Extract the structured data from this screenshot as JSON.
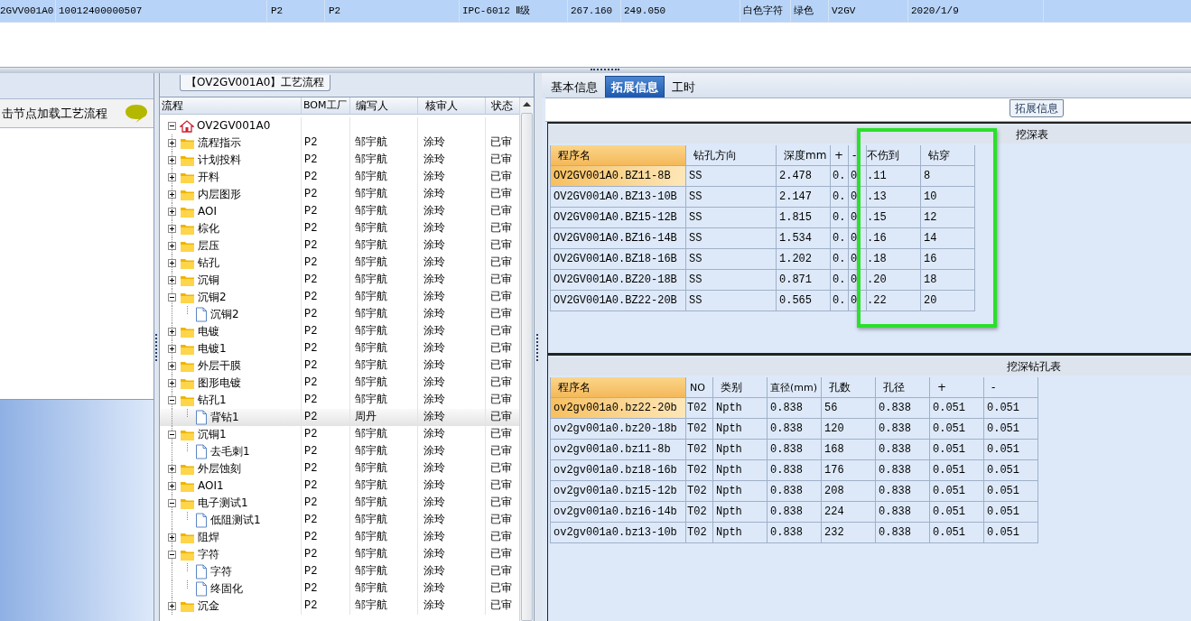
{
  "top_grid": {
    "row": {
      "selected": true,
      "cells": [
        "2GVV001A0",
        "10012400000507",
        "P2",
        "P2",
        "IPC-6012 Ⅱ级",
        "267.160",
        "249.050",
        "白色字符",
        "绿色",
        "V2GV",
        "2020/1/9"
      ]
    }
  },
  "flow_list": {
    "hint": "击节点加载工艺流程"
  },
  "process_panel": {
    "title": "【OV2GV001A0】工艺流程",
    "columns": [
      "流程",
      "BOM工厂",
      "编写人",
      "核审人",
      "状态"
    ],
    "tree": [
      {
        "label": "OV2GV001A0",
        "kind": "home",
        "expanded": true,
        "selected": false,
        "children": [
          {
            "label": "流程指示",
            "kind": "folder",
            "expanded": false,
            "selected": false,
            "bom": "P2",
            "author": "邹宇航",
            "reviewer": "涂玲",
            "status": "已审"
          },
          {
            "label": "计划投料",
            "kind": "folder",
            "expanded": false,
            "selected": false,
            "bom": "P2",
            "author": "邹宇航",
            "reviewer": "涂玲",
            "status": "已审"
          },
          {
            "label": "开料",
            "kind": "folder",
            "expanded": false,
            "selected": false,
            "bom": "P2",
            "author": "邹宇航",
            "reviewer": "涂玲",
            "status": "已审"
          },
          {
            "label": "内层图形",
            "kind": "folder",
            "expanded": false,
            "selected": false,
            "bom": "P2",
            "author": "邹宇航",
            "reviewer": "涂玲",
            "status": "已审"
          },
          {
            "label": "AOI",
            "kind": "folder",
            "expanded": false,
            "selected": false,
            "bom": "P2",
            "author": "邹宇航",
            "reviewer": "涂玲",
            "status": "已审"
          },
          {
            "label": "棕化",
            "kind": "folder",
            "expanded": false,
            "selected": false,
            "bom": "P2",
            "author": "邹宇航",
            "reviewer": "涂玲",
            "status": "已审"
          },
          {
            "label": "层压",
            "kind": "folder",
            "expanded": false,
            "selected": false,
            "bom": "P2",
            "author": "邹宇航",
            "reviewer": "涂玲",
            "status": "已审"
          },
          {
            "label": "钻孔",
            "kind": "folder",
            "expanded": false,
            "selected": false,
            "bom": "P2",
            "author": "邹宇航",
            "reviewer": "涂玲",
            "status": "已审"
          },
          {
            "label": "沉铜",
            "kind": "folder",
            "expanded": false,
            "selected": false,
            "bom": "P2",
            "author": "邹宇航",
            "reviewer": "涂玲",
            "status": "已审"
          },
          {
            "label": "沉铜2",
            "kind": "folder",
            "expanded": true,
            "selected": false,
            "bom": "P2",
            "author": "邹宇航",
            "reviewer": "涂玲",
            "status": "已审",
            "children": [
              {
                "label": "沉铜2",
                "kind": "file",
                "selected": false,
                "bom": "P2",
                "author": "邹宇航",
                "reviewer": "涂玲",
                "status": "已审"
              }
            ]
          },
          {
            "label": "电镀",
            "kind": "folder",
            "expanded": false,
            "selected": false,
            "bom": "P2",
            "author": "邹宇航",
            "reviewer": "涂玲",
            "status": "已审"
          },
          {
            "label": "电镀1",
            "kind": "folder",
            "expanded": false,
            "selected": false,
            "bom": "P2",
            "author": "邹宇航",
            "reviewer": "涂玲",
            "status": "已审"
          },
          {
            "label": "外层干膜",
            "kind": "folder",
            "expanded": false,
            "selected": false,
            "bom": "P2",
            "author": "邹宇航",
            "reviewer": "涂玲",
            "status": "已审"
          },
          {
            "label": "图形电镀",
            "kind": "folder",
            "expanded": false,
            "selected": false,
            "bom": "P2",
            "author": "邹宇航",
            "reviewer": "涂玲",
            "status": "已审"
          },
          {
            "label": "钻孔1",
            "kind": "folder",
            "expanded": true,
            "selected": false,
            "bom": "P2",
            "author": "邹宇航",
            "reviewer": "涂玲",
            "status": "已审",
            "children": [
              {
                "label": "背钻1",
                "kind": "file",
                "selected": true,
                "bom": "P2",
                "author": "周丹",
                "reviewer": "涂玲",
                "status": "已审"
              }
            ]
          },
          {
            "label": "沉铜1",
            "kind": "folder",
            "expanded": true,
            "selected": false,
            "bom": "P2",
            "author": "邹宇航",
            "reviewer": "涂玲",
            "status": "已审",
            "children": [
              {
                "label": "去毛刺1",
                "kind": "file",
                "selected": false,
                "bom": "P2",
                "author": "邹宇航",
                "reviewer": "涂玲",
                "status": "已审"
              }
            ]
          },
          {
            "label": "外层蚀刻",
            "kind": "folder",
            "expanded": false,
            "selected": false,
            "bom": "P2",
            "author": "邹宇航",
            "reviewer": "涂玲",
            "status": "已审"
          },
          {
            "label": "AOI1",
            "kind": "folder",
            "expanded": false,
            "selected": false,
            "bom": "P2",
            "author": "邹宇航",
            "reviewer": "涂玲",
            "status": "已审"
          },
          {
            "label": "电子测试1",
            "kind": "folder",
            "expanded": true,
            "selected": false,
            "bom": "P2",
            "author": "邹宇航",
            "reviewer": "涂玲",
            "status": "已审",
            "children": [
              {
                "label": "低阻测试1",
                "kind": "file",
                "selected": false,
                "bom": "P2",
                "author": "邹宇航",
                "reviewer": "涂玲",
                "status": "已审"
              }
            ]
          },
          {
            "label": "阻焊",
            "kind": "folder",
            "expanded": false,
            "selected": false,
            "bom": "P2",
            "author": "邹宇航",
            "reviewer": "涂玲",
            "status": "已审"
          },
          {
            "label": "字符",
            "kind": "folder",
            "expanded": true,
            "selected": false,
            "bom": "P2",
            "author": "邹宇航",
            "reviewer": "涂玲",
            "status": "已审",
            "children": [
              {
                "label": "字符",
                "kind": "file",
                "selected": false,
                "bom": "P2",
                "author": "邹宇航",
                "reviewer": "涂玲",
                "status": "已审"
              },
              {
                "label": "终固化",
                "kind": "file",
                "selected": false,
                "bom": "P2",
                "author": "邹宇航",
                "reviewer": "涂玲",
                "status": "已审"
              }
            ]
          },
          {
            "label": "沉金",
            "kind": "folder",
            "expanded": false,
            "selected": false,
            "bom": "P2",
            "author": "邹宇航",
            "reviewer": "涂玲",
            "status": "已审"
          }
        ]
      }
    ]
  },
  "detail_panel": {
    "tabs": [
      {
        "label": "基本信息",
        "selected": false
      },
      {
        "label": "拓展信息",
        "selected": true
      },
      {
        "label": "工时",
        "selected": false
      }
    ],
    "group_title": "拓展信息",
    "annotations": [
      {
        "kind": "frame"
      }
    ],
    "tables": [
      {
        "title": "挖深表",
        "kind": "depth",
        "columns": [
          {
            "label": "程序名",
            "sorted": true
          },
          {
            "label": "钻孔方向",
            "sorted": false
          },
          {
            "label": "深度mm",
            "sorted": false
          },
          {
            "label": "+",
            "sorted": false
          },
          {
            "label": "-",
            "sorted": false
          },
          {
            "label": "不伤到",
            "sorted": false
          },
          {
            "label": "钻穿",
            "sorted": false
          }
        ],
        "rows": [
          {
            "selected": true,
            "cells": [
              "OV2GV001A0.BZ11-8B",
              "SS",
              "2.478",
              "0..",
              "0",
              ".11",
              "8"
            ]
          },
          {
            "selected": false,
            "cells": [
              "OV2GV001A0.BZ13-10B",
              "SS",
              "2.147",
              "0..",
              "0",
              ".13",
              "10"
            ]
          },
          {
            "selected": false,
            "cells": [
              "OV2GV001A0.BZ15-12B",
              "SS",
              "1.815",
              "0..",
              "0",
              ".15",
              "12"
            ]
          },
          {
            "selected": false,
            "cells": [
              "OV2GV001A0.BZ16-14B",
              "SS",
              "1.534",
              "0..",
              "0",
              ".16",
              "14"
            ]
          },
          {
            "selected": false,
            "cells": [
              "OV2GV001A0.BZ18-16B",
              "SS",
              "1.202",
              "0..",
              "0",
              ".18",
              "16"
            ]
          },
          {
            "selected": false,
            "cells": [
              "OV2GV001A0.BZ20-18B",
              "SS",
              "0.871",
              "0..",
              "0",
              ".20",
              "18"
            ]
          },
          {
            "selected": false,
            "cells": [
              "OV2GV001A0.BZ22-20B",
              "SS",
              "0.565",
              "0..",
              "0",
              ".22",
              "20"
            ]
          }
        ]
      },
      {
        "title": "挖深钻孔表",
        "kind": "holes",
        "columns": [
          {
            "label": "程序名",
            "sorted": true
          },
          {
            "label": "NO",
            "sorted": false
          },
          {
            "label": "类别",
            "sorted": false
          },
          {
            "label": "直径(mm)",
            "sorted": false
          },
          {
            "label": "孔数",
            "sorted": false
          },
          {
            "label": "孔径",
            "sorted": false
          },
          {
            "label": "+",
            "sorted": false
          },
          {
            "label": "-",
            "sorted": false
          }
        ],
        "rows": [
          {
            "selected": true,
            "cells": [
              "ov2gv001a0.bz22-20b",
              "T02",
              "Npth",
              "0.838",
              "56",
              "0.838",
              "0.051",
              "0.051"
            ]
          },
          {
            "selected": false,
            "cells": [
              "ov2gv001a0.bz20-18b",
              "T02",
              "Npth",
              "0.838",
              "120",
              "0.838",
              "0.051",
              "0.051"
            ]
          },
          {
            "selected": false,
            "cells": [
              "ov2gv001a0.bz11-8b",
              "T02",
              "Npth",
              "0.838",
              "168",
              "0.838",
              "0.051",
              "0.051"
            ]
          },
          {
            "selected": false,
            "cells": [
              "ov2gv001a0.bz18-16b",
              "T02",
              "Npth",
              "0.838",
              "176",
              "0.838",
              "0.051",
              "0.051"
            ]
          },
          {
            "selected": false,
            "cells": [
              "ov2gv001a0.bz15-12b",
              "T02",
              "Npth",
              "0.838",
              "208",
              "0.838",
              "0.051",
              "0.051"
            ]
          },
          {
            "selected": false,
            "cells": [
              "ov2gv001a0.bz16-14b",
              "T02",
              "Npth",
              "0.838",
              "224",
              "0.838",
              "0.051",
              "0.051"
            ]
          },
          {
            "selected": false,
            "cells": [
              "ov2gv001a0.bz13-10b",
              "T02",
              "Npth",
              "0.838",
              "232",
              "0.838",
              "0.051",
              "0.051"
            ]
          }
        ]
      }
    ]
  }
}
